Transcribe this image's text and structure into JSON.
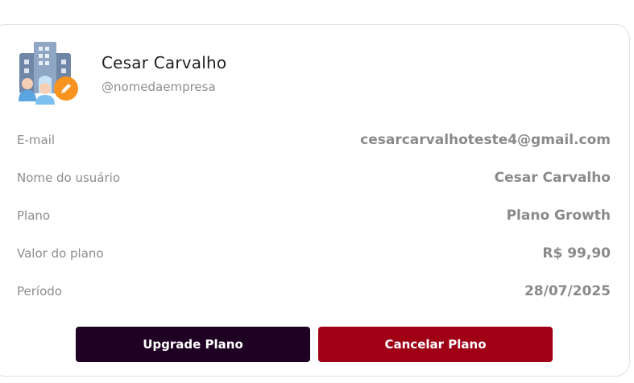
{
  "profile": {
    "name": "Cesar Carvalho",
    "handle": "@nomedaempresa",
    "avatar_icon": "company-building-users-icon",
    "edit_icon": "pencil-icon"
  },
  "details": [
    {
      "label": "E-mail",
      "value": "cesarcarvalhoteste4@gmail.com"
    },
    {
      "label": "Nome do usuário",
      "value": "Cesar Carvalho"
    },
    {
      "label": "Plano",
      "value": "Plano Growth"
    },
    {
      "label": "Valor do plano",
      "value": "R$ 99,90"
    },
    {
      "label": "Período",
      "value": "28/07/2025"
    }
  ],
  "actions": {
    "upgrade_label": "Upgrade Plano",
    "cancel_label": "Cancelar Plano"
  },
  "colors": {
    "upgrade_button": "#1f0223",
    "cancel_button": "#a00015",
    "edit_badge": "#f7931e"
  }
}
